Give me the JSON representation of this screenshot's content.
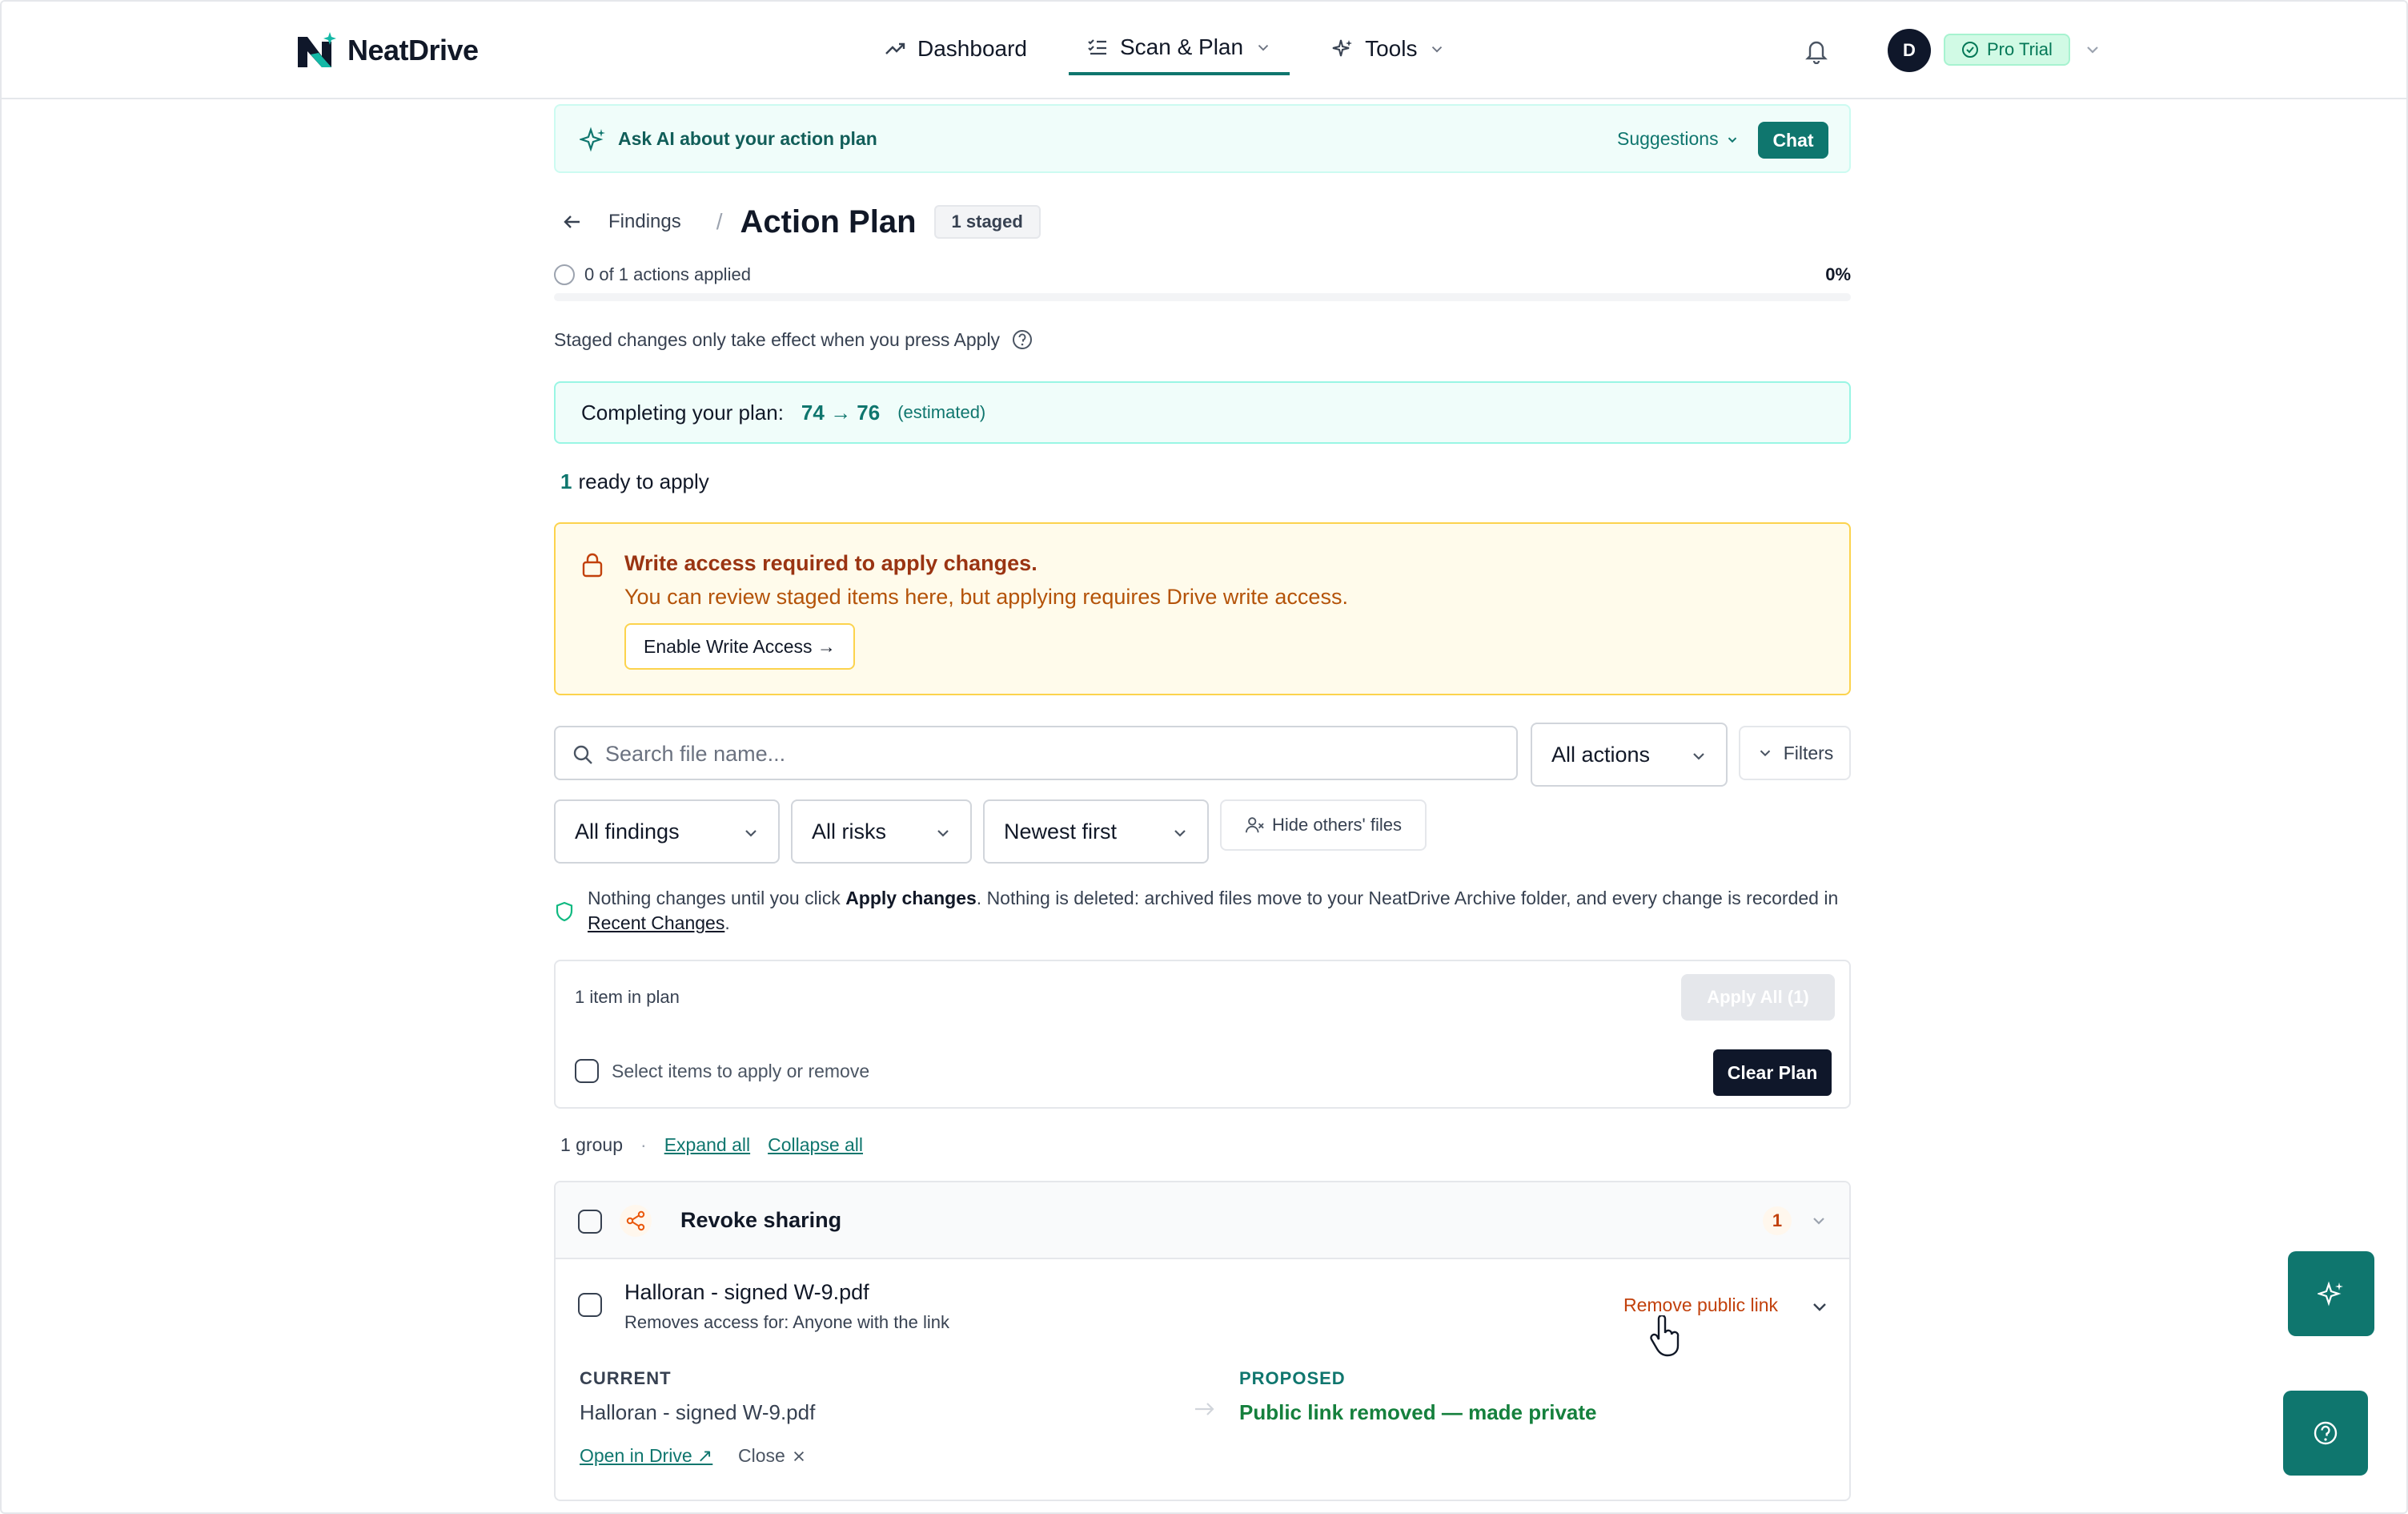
{
  "brand": {
    "name": "NeatDrive"
  },
  "nav": {
    "items": [
      {
        "label": "Dashboard",
        "icon": "trend-icon"
      },
      {
        "label": "Scan & Plan",
        "icon": "checklist-icon",
        "active": true
      },
      {
        "label": "Tools",
        "icon": "sparkle-icon"
      }
    ]
  },
  "user": {
    "avatar_initial": "D",
    "plan_badge": "Pro Trial"
  },
  "ai_bar": {
    "label": "Ask AI about your action plan",
    "suggestions": "Suggestions",
    "chat": "Chat"
  },
  "breadcrumb": {
    "parent": "Findings",
    "separator": "/",
    "title": "Action Plan",
    "badge": "1 staged"
  },
  "progress": {
    "text": "0 of 1 actions applied",
    "percent_label": "0%",
    "fraction": 0.0
  },
  "staged_note": "Staged changes only take effect when you press Apply",
  "completing": {
    "label": "Completing your plan:",
    "score": "74 → 76",
    "note": "(estimated)"
  },
  "ready": {
    "count": "1",
    "text": "ready to apply"
  },
  "warning": {
    "title": "Write access required to apply changes.",
    "body": "You can review staged items here, but applying requires Drive write access.",
    "button": "Enable Write Access →"
  },
  "search": {
    "placeholder": "Search file name...",
    "value": ""
  },
  "filters": {
    "actions": "All actions",
    "filters_button": "Filters",
    "findings": "All findings",
    "risks": "All risks",
    "sort": "Newest first",
    "hide_others": "Hide others' files"
  },
  "info": {
    "part1": "Nothing changes until you click ",
    "bold": "Apply changes",
    "part2": ". Nothing is deleted: archived files move to your NeatDrive Archive folder, and every change is recorded in ",
    "link": "Recent Changes",
    "part3": "."
  },
  "plan": {
    "count_label": "1 item in plan",
    "apply_all": "Apply All (1)",
    "select_label": "Select items to apply or remove",
    "clear": "Clear Plan"
  },
  "groups_row": {
    "count": "1 group",
    "dot": "·",
    "expand": "Expand all",
    "collapse": "Collapse all"
  },
  "group": {
    "title": "Revoke sharing",
    "count": "1",
    "item": {
      "name": "Halloran - signed W-9.pdf",
      "sub": "Removes access for: Anyone with the link",
      "action": "Remove public link",
      "current_header": "CURRENT",
      "current_value": "Halloran - signed W-9.pdf",
      "proposed_header": "PROPOSED",
      "proposed_value": "Public link removed — made private",
      "open": "Open in Drive ↗",
      "close": "Close"
    }
  },
  "colors": {
    "accent": "#0f766e",
    "warning_bg": "#fffbeb",
    "warning_text": "#9a3412",
    "dark": "#0f172a"
  }
}
